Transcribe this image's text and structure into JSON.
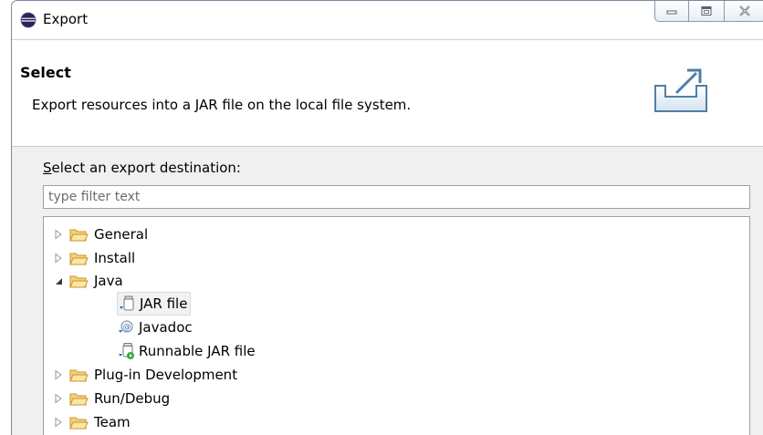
{
  "window": {
    "title": "Export"
  },
  "banner": {
    "title": "Select",
    "description": "Export resources into a JAR file on the local file system."
  },
  "destination": {
    "label_mnemonic": "S",
    "label_rest": "elect an export destination:",
    "filter_placeholder": "type filter text"
  },
  "tree": {
    "general": "General",
    "install": "Install",
    "java": "Java",
    "jar_file": "JAR file",
    "javadoc": "Javadoc",
    "runnable_jar": "Runnable JAR file",
    "plugin_dev": "Plug-in Development",
    "run_debug": "Run/Debug",
    "team": "Team",
    "selected_item": "JAR file"
  },
  "icons": {
    "title": "eclipse-icon",
    "minimize": "minimize-icon",
    "maximize": "maximize-icon",
    "close": "close-icon",
    "banner": "export-icon",
    "folder": "folder-icon",
    "expand": "triangle-right-icon",
    "collapse": "triangle-down-icon",
    "jar": "jar-file-icon",
    "javadoc": "javadoc-icon",
    "runnable": "runnable-jar-icon"
  },
  "colors": {
    "folder_fill": "#f4d27a",
    "folder_stroke": "#c8962a",
    "selection_bg": "#f2f2f2",
    "window_border": "#7a8ba0"
  }
}
